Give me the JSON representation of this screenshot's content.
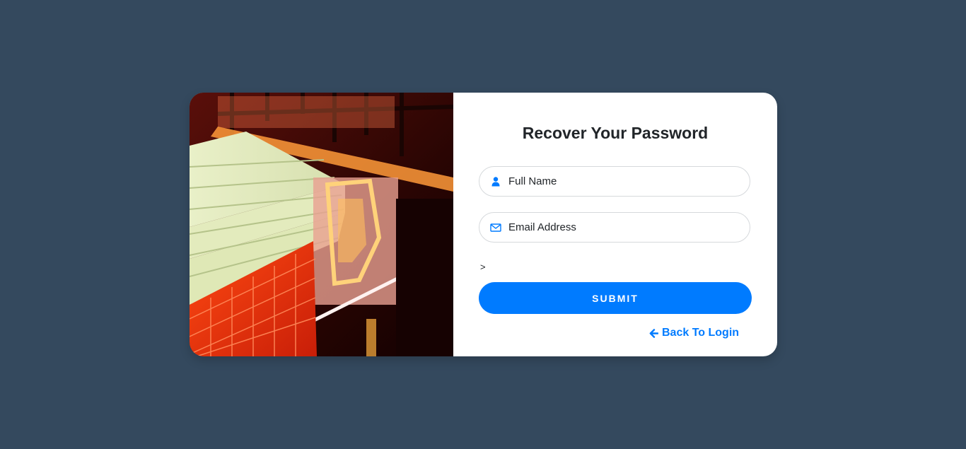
{
  "form": {
    "title": "Recover Your Password",
    "full_name": {
      "placeholder": "Full Name",
      "value": "",
      "icon": "user-icon"
    },
    "email": {
      "placeholder": "Email Address",
      "value": "",
      "icon": "envelope-icon"
    },
    "stray_text": ">",
    "submit_label": "SUBMIT",
    "back_link": {
      "label": "Back To Login",
      "icon": "arrow-left-icon"
    }
  },
  "colors": {
    "page_background": "#34495e",
    "card_background": "#ffffff",
    "accent": "#007bff",
    "text": "#212529"
  },
  "image": {
    "subject": "neon-lit building photo",
    "icon": "photo-icon"
  }
}
